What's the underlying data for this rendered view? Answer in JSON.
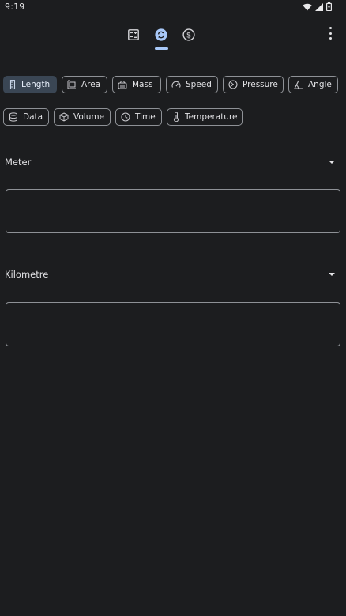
{
  "status_bar": {
    "time": "9:19",
    "icons": [
      "wifi-icon",
      "signal-icon",
      "battery-icon"
    ]
  },
  "top_tabs": {
    "items": [
      {
        "name": "calculator",
        "icon": "calculator-icon"
      },
      {
        "name": "converter",
        "icon": "converter-icon",
        "selected": true
      },
      {
        "name": "currency",
        "icon": "currency-icon"
      }
    ],
    "accent_color": "#a8c8f8"
  },
  "categories": [
    {
      "label": "Length",
      "icon": "ruler-icon",
      "selected": true
    },
    {
      "label": "Area",
      "icon": "area-icon"
    },
    {
      "label": "Mass",
      "icon": "scale-icon"
    },
    {
      "label": "Speed",
      "icon": "speedometer-icon"
    },
    {
      "label": "Pressure",
      "icon": "gauge-icon"
    },
    {
      "label": "Angle",
      "icon": "angle-icon"
    },
    {
      "label": "Data",
      "icon": "database-icon"
    },
    {
      "label": "Volume",
      "icon": "cube-icon"
    },
    {
      "label": "Time",
      "icon": "clock-icon"
    },
    {
      "label": "Temperature",
      "icon": "thermometer-icon"
    }
  ],
  "from_unit": {
    "label": "Meter",
    "value": ""
  },
  "to_unit": {
    "label": "Kilometre",
    "value": ""
  },
  "colors": {
    "background": "#1c1d1f",
    "selected_chip": "#3a4654",
    "outline": "#8e9196",
    "text": "#e3e3e6"
  }
}
